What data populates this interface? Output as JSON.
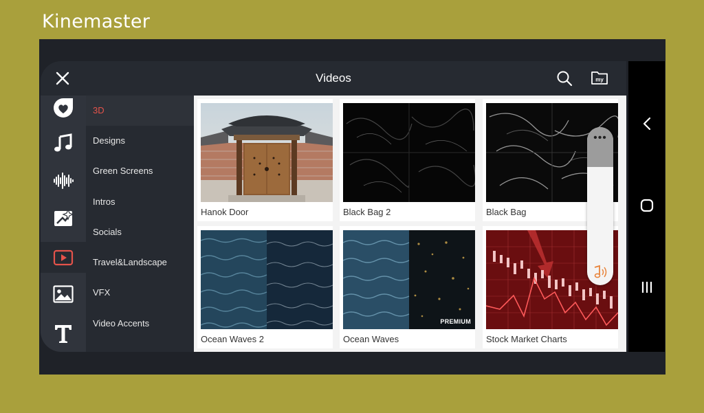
{
  "brand": "Kinemaster",
  "header": {
    "title": "Videos"
  },
  "categories": [
    {
      "label": "3D",
      "active": true
    },
    {
      "label": "Designs"
    },
    {
      "label": "Green Screens"
    },
    {
      "label": "Intros"
    },
    {
      "label": "Socials"
    },
    {
      "label": "Travel&Landscape"
    },
    {
      "label": "VFX"
    },
    {
      "label": "Video Accents"
    }
  ],
  "sidebar_icons": [
    "sticker-heart-icon",
    "music-note-icon",
    "sound-wave-icon",
    "effect-sparkle-icon",
    "video-play-icon",
    "image-icon",
    "text-icon"
  ],
  "items": [
    {
      "label": "Hanok Door"
    },
    {
      "label": "Black Bag 2"
    },
    {
      "label": "Black Bag"
    },
    {
      "label": "Ocean Waves 2"
    },
    {
      "label": "Ocean Waves",
      "badge": "PREMIUM"
    },
    {
      "label": "Stock Market Charts"
    }
  ],
  "colors": {
    "accent": "#e5534b",
    "background": "#a9a03c",
    "panel": "#262a31"
  }
}
